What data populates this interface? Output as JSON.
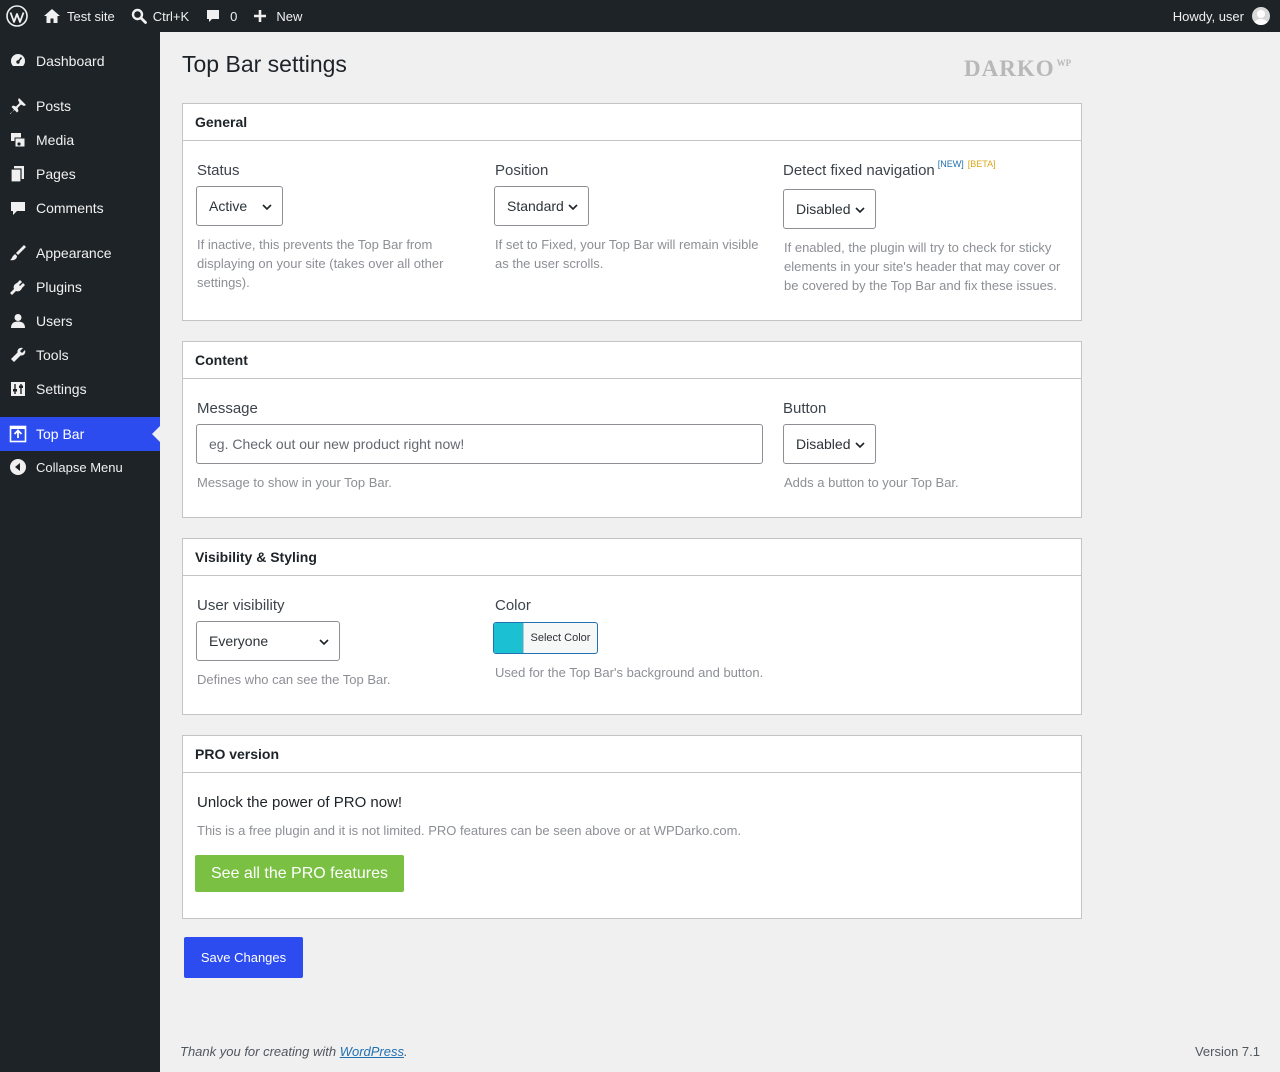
{
  "adminbar": {
    "site_name": "Test site",
    "search_shortcut": "Ctrl+K",
    "comments_count": "0",
    "new_label": "New",
    "greeting": "Howdy, user"
  },
  "sidebar": {
    "items": [
      {
        "label": "Dashboard",
        "icon": "dashboard-icon"
      },
      {
        "label": "Posts",
        "icon": "pushpin-icon"
      },
      {
        "label": "Media",
        "icon": "media-icon"
      },
      {
        "label": "Pages",
        "icon": "pages-icon"
      },
      {
        "label": "Comments",
        "icon": "comment-icon"
      },
      {
        "label": "Appearance",
        "icon": "paintbrush-icon"
      },
      {
        "label": "Plugins",
        "icon": "plug-icon"
      },
      {
        "label": "Users",
        "icon": "user-icon"
      },
      {
        "label": "Tools",
        "icon": "wrench-icon"
      },
      {
        "label": "Settings",
        "icon": "sliders-icon"
      },
      {
        "label": "Top Bar",
        "icon": "upload-icon",
        "current": true
      },
      {
        "label": "Collapse Menu",
        "icon": "collapse-icon"
      }
    ]
  },
  "page": {
    "title": "Top Bar settings",
    "logo_text": "DARKO",
    "logo_sup": "WP"
  },
  "general": {
    "heading": "General",
    "status_label": "Status",
    "status_value": "Active",
    "status_help": "If inactive, this prevents the Top Bar from displaying on your site (takes over all other settings).",
    "position_label": "Position",
    "position_value": "Standard",
    "position_help": "If set to Fixed, your Top Bar will remain visible as the user scrolls.",
    "detect_label": "Detect fixed navigation",
    "detect_badge_new": "[NEW]",
    "detect_badge_beta": "[BETA]",
    "detect_value": "Disabled",
    "detect_help": "If enabled, the plugin will try to check for sticky elements in your site's header that may cover or be covered by the Top Bar and fix these issues."
  },
  "content": {
    "heading": "Content",
    "message_label": "Message",
    "message_value": "",
    "message_placeholder": "eg. Check out our new product right now!",
    "message_help": "Message to show in your Top Bar.",
    "button_label": "Button",
    "button_value": "Disabled",
    "button_help": "Adds a button to your Top Bar."
  },
  "visibility": {
    "heading": "Visibility & Styling",
    "user_visibility_label": "User visibility",
    "user_visibility_value": "Everyone",
    "user_visibility_help": "Defines who can see the Top Bar.",
    "color_label": "Color",
    "color_button": "Select Color",
    "color_value": "#1bc0d3",
    "color_help": "Used for the Top Bar's background and button."
  },
  "pro": {
    "heading": "PRO version",
    "title": "Unlock the power of PRO now!",
    "description": "This is a free plugin and it is not limited. PRO features can be seen above or at WPDarko.com.",
    "button": "See all the PRO features"
  },
  "save_button": "Save Changes",
  "footer": {
    "thanks_prefix": "Thank you for creating with ",
    "thanks_link": "WordPress",
    "thanks_suffix": ".",
    "version": "Version 7.1"
  },
  "colors": {
    "accent": "#2c4cf0",
    "pro_green": "#7ac143",
    "chrome": "#1d2327"
  }
}
